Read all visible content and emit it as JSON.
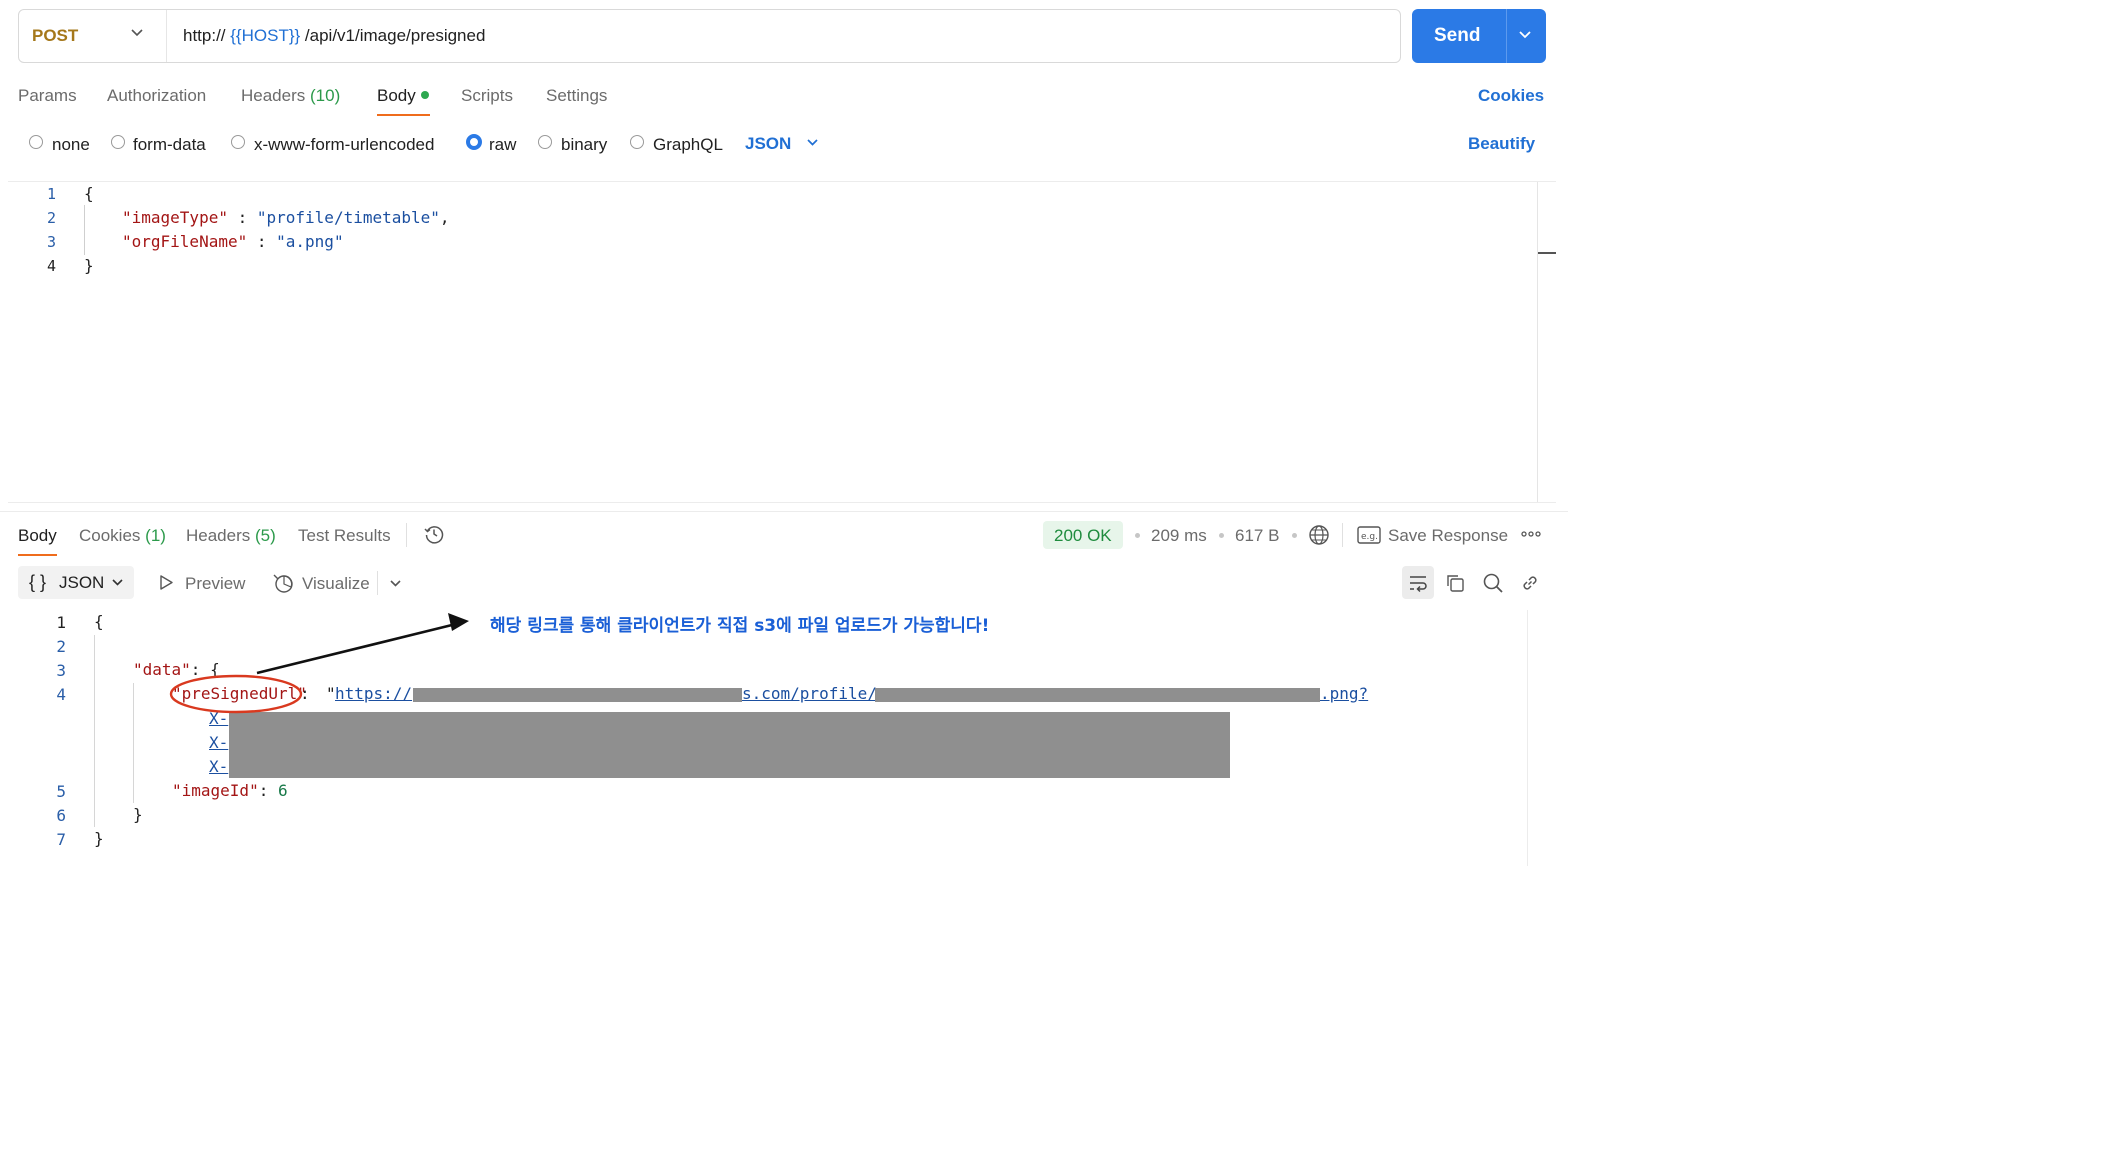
{
  "request": {
    "method": "POST",
    "url_prefix": "http:// ",
    "url_variable": "{{HOST}}",
    "url_path": " /api/v1/image/presigned",
    "send_label": "Send"
  },
  "request_tabs": {
    "params": "Params",
    "authorization": "Authorization",
    "headers": "Headers",
    "headers_count": "(10)",
    "body": "Body",
    "scripts": "Scripts",
    "settings": "Settings",
    "cookies": "Cookies"
  },
  "body_types": {
    "none": "none",
    "form_data": "form-data",
    "urlencoded": "x-www-form-urlencoded",
    "raw": "raw",
    "binary": "binary",
    "graphql": "GraphQL",
    "selected": "raw",
    "language": "JSON",
    "beautify": "Beautify"
  },
  "request_body": {
    "line_numbers": [
      "1",
      "2",
      "3",
      "4"
    ],
    "open_brace": "{",
    "key1": "\"imageType\"",
    "val1": "\"profile/timetable\"",
    "key2": "\"orgFileName\"",
    "val2": "\"a.png\"",
    "close_brace": "}",
    "colon": " : ",
    "comma": ","
  },
  "response_tabs": {
    "body": "Body",
    "cookies": "Cookies",
    "cookies_count": "(1)",
    "headers": "Headers",
    "headers_count": "(5)",
    "test_results": "Test Results"
  },
  "response_meta": {
    "status": "200 OK",
    "time": "209 ms",
    "size": "617 B",
    "save_response": "Save Response"
  },
  "response_toolbar": {
    "format_braces": "{ }",
    "format": "JSON",
    "preview": "Preview",
    "visualize": "Visualize"
  },
  "response_body": {
    "line_numbers": [
      "1",
      "2",
      "3",
      "4",
      "5",
      "6",
      "7"
    ],
    "open_brace": "{",
    "data_key": "\"data\"",
    "data_open": ": {",
    "presigned_key": "\"preSignedUrl\"",
    "colon": ": ",
    "url_quote": "\"",
    "url_part1": "https://",
    "url_part2": "s.com/profile/",
    "url_part3": ".png?",
    "url_cont": "X-",
    "imageid_key": "\"imageId\"",
    "imageid_value": "6",
    "inner_close": "}",
    "close_brace": "}"
  },
  "annotation": {
    "text": "해당 링크를 통해 클라이언트가 직접 s3에 파일 업로드가 가능합니다!",
    "color": "#1a5fd6",
    "circle_color": "#d9391f"
  },
  "colors": {
    "accent": "#2b7ae6",
    "method": "#a5781b",
    "tab_underline": "#ef6c1c",
    "status_ok": "#1f8c3e"
  }
}
